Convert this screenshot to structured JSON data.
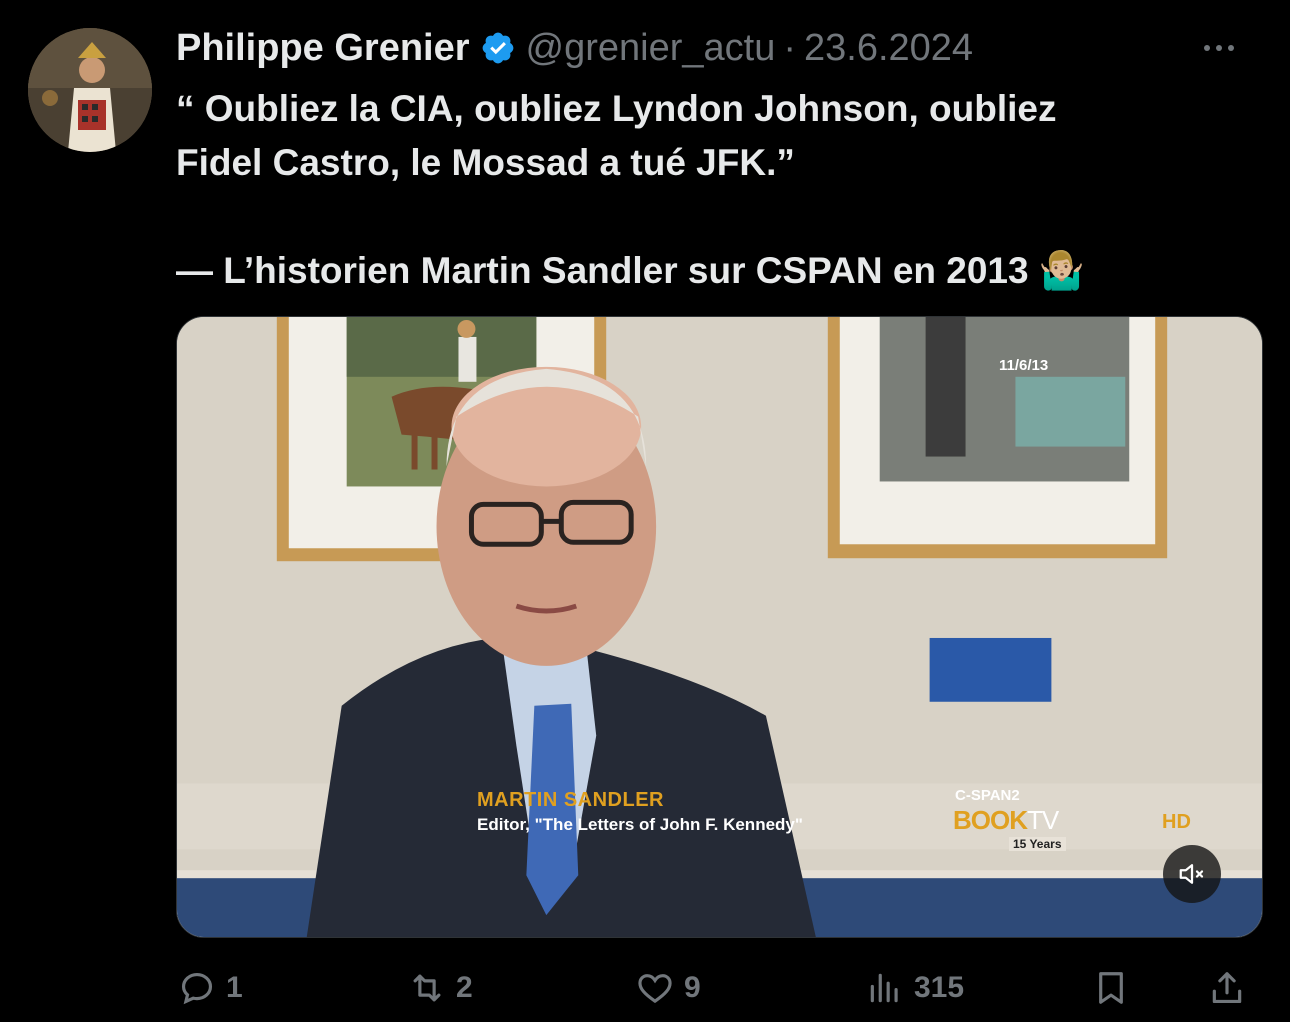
{
  "author": {
    "name": "Philippe Grenier",
    "handle": "@grenier_actu",
    "separator": "·",
    "date": "23.6.2024"
  },
  "tweet": {
    "line1": "“ Oubliez la CIA, oubliez Lyndon Johnson, oubliez",
    "line2": "Fidel Castro, le Mossad a tué JFK.”",
    "line3": "— L’historien Martin Sandler sur CSPAN en 2013 🤷🏼‍♂️"
  },
  "media": {
    "date_stamp": "11/6/13",
    "chyron_name": "MARTIN SANDLER",
    "chyron_title": "Editor, \"The Letters of John F. Kennedy\"",
    "network": "C-SPAN2",
    "show_book": "BOOK",
    "show_tv": "TV",
    "anniversary": "15 Years",
    "hd": "HD"
  },
  "actions": {
    "replies": "1",
    "reposts": "2",
    "likes": "9",
    "views": "315"
  },
  "icons": [
    "verified-badge-icon",
    "more-icon",
    "mute-icon",
    "reply-icon",
    "repost-icon",
    "like-icon",
    "views-icon",
    "bookmark-icon",
    "share-icon"
  ],
  "colors": {
    "verified": "#1d9bf0",
    "muted_text": "#71767b",
    "text": "#e7e9ea",
    "chyron_gold": "#e0a020"
  }
}
